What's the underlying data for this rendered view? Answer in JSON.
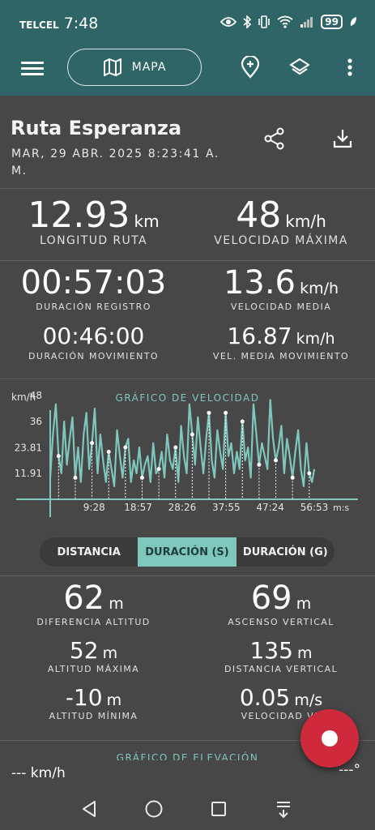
{
  "status_bar": {
    "carrier": "TELCEL",
    "time": "7:48",
    "battery": "99"
  },
  "app_bar": {
    "map_label": "MAPA"
  },
  "route": {
    "title": "Ruta Esperanza",
    "date": "MAR, 29 ABR. 2025 8:23:41 A. M."
  },
  "stats_top": [
    {
      "value": "12.93",
      "unit": "km",
      "label": "LONGITUD RUTA"
    },
    {
      "value": "48",
      "unit": "km/h",
      "label": "VELOCIDAD MÁXIMA"
    }
  ],
  "stats_time": [
    {
      "value": "00:57:03",
      "unit": "",
      "label": "DURACIÓN REGISTRO"
    },
    {
      "value": "13.6",
      "unit": "km/h",
      "label": "VELOCIDAD MEDIA"
    },
    {
      "value": "00:46:00",
      "unit": "",
      "label": "DURACIÓN MOVIMIENTO"
    },
    {
      "value": "16.87",
      "unit": "km/h",
      "label": "VEL. MEDIA MOVIMIENTO"
    }
  ],
  "speed_chart": {
    "title": "GRÁFICO DE VELOCIDAD",
    "y_unit_label": "km/h",
    "y_ticks": [
      "48",
      "36",
      "23.81",
      "11.91"
    ],
    "x_ticks": [
      "9:28",
      "18:57",
      "28:26",
      "37:55",
      "47:24",
      "56:53"
    ],
    "x_unit_label": "m:s"
  },
  "chart_data": {
    "type": "line",
    "title": "GRÁFICO DE VELOCIDAD",
    "ylabel": "km/h",
    "xlabel": "m:s",
    "ylim": [
      0,
      48
    ],
    "x_tick_minutes": [
      9.47,
      18.95,
      28.43,
      37.92,
      47.4,
      56.88
    ],
    "x_tick_labels": [
      "9:28",
      "18:57",
      "28:26",
      "37:55",
      "47:24",
      "56:53"
    ],
    "y_tick_values": [
      48,
      36,
      23.81,
      11.91
    ],
    "grid": false,
    "series": [
      {
        "x": [
          0.0,
          0.6,
          1.2,
          1.8,
          2.4,
          3.0,
          3.6,
          4.2,
          4.8,
          5.4,
          6.0,
          6.6,
          7.2,
          7.8,
          8.4,
          9.0,
          9.6,
          10.2,
          10.8,
          11.4,
          12.0,
          12.6,
          13.2,
          13.8,
          14.4,
          15.0,
          15.6,
          16.2,
          16.8,
          17.4,
          18.0,
          18.6,
          19.2,
          19.8,
          20.4,
          21.0,
          21.6,
          22.2,
          22.8,
          23.4,
          24.0,
          24.6,
          25.2,
          25.8,
          26.4,
          27.0,
          27.6,
          28.2,
          28.8,
          29.4,
          30.0,
          30.6,
          31.2,
          31.8,
          32.4,
          33.0,
          33.6,
          34.2,
          34.8,
          35.4,
          36.0,
          36.6,
          37.2,
          37.8,
          38.4,
          39.0,
          39.6,
          40.2,
          40.8,
          41.4,
          42.0,
          42.6,
          43.2,
          43.8,
          44.4,
          45.0,
          45.6,
          46.2,
          46.8,
          47.4,
          48.0,
          48.6,
          49.2,
          49.8,
          50.4,
          51.0,
          51.6,
          52.2,
          52.8,
          53.4,
          54.0,
          54.6,
          55.2,
          55.8,
          56.4,
          56.9
        ],
        "y": [
          10,
          30,
          44,
          20,
          12,
          36,
          16,
          28,
          38,
          10,
          24,
          8,
          30,
          40,
          14,
          26,
          42,
          12,
          30,
          18,
          8,
          22,
          14,
          6,
          32,
          20,
          10,
          24,
          28,
          8,
          18,
          12,
          24,
          10,
          16,
          20,
          8,
          26,
          12,
          14,
          22,
          10,
          30,
          18,
          14,
          24,
          8,
          34,
          20,
          12,
          44,
          30,
          16,
          38,
          24,
          12,
          28,
          40,
          18,
          10,
          32,
          22,
          14,
          40,
          20,
          26,
          12,
          22,
          14,
          36,
          18,
          24,
          10,
          44,
          30,
          16,
          26,
          20,
          14,
          46,
          28,
          18,
          24,
          34,
          12,
          28,
          20,
          10,
          22,
          32,
          14,
          6,
          26,
          12,
          8,
          14
        ]
      }
    ]
  },
  "segment_tabs": [
    "DISTANCIA",
    "DURACIÓN (S)",
    "DURACIÓN (G)"
  ],
  "stats_alt": [
    {
      "value": "62",
      "unit": "m",
      "label": "DIFERENCIA ALTITUD"
    },
    {
      "value": "69",
      "unit": "m",
      "label": "ASCENSO VERTICAL"
    },
    {
      "value": "52",
      "unit": "m",
      "label": "ALTITUD MÁXIMA"
    },
    {
      "value": "135",
      "unit": "m",
      "label": "DISTANCIA VERTICAL"
    },
    {
      "value": "-10",
      "unit": "m",
      "label": "ALTITUD MÍNIMA"
    },
    {
      "value": "0.05",
      "unit": "m/s",
      "label": "VELOCIDAD VE"
    }
  ],
  "elevation_chart_title": "GRÁFICO DE ELEVACIÓN",
  "bottom_bar": {
    "speed": "--- km/h",
    "heading": "---°"
  },
  "colors": {
    "teal_header": "#2f6566",
    "accent": "#7fc7bd",
    "background": "#474747",
    "record_red": "#cf2a3c"
  }
}
